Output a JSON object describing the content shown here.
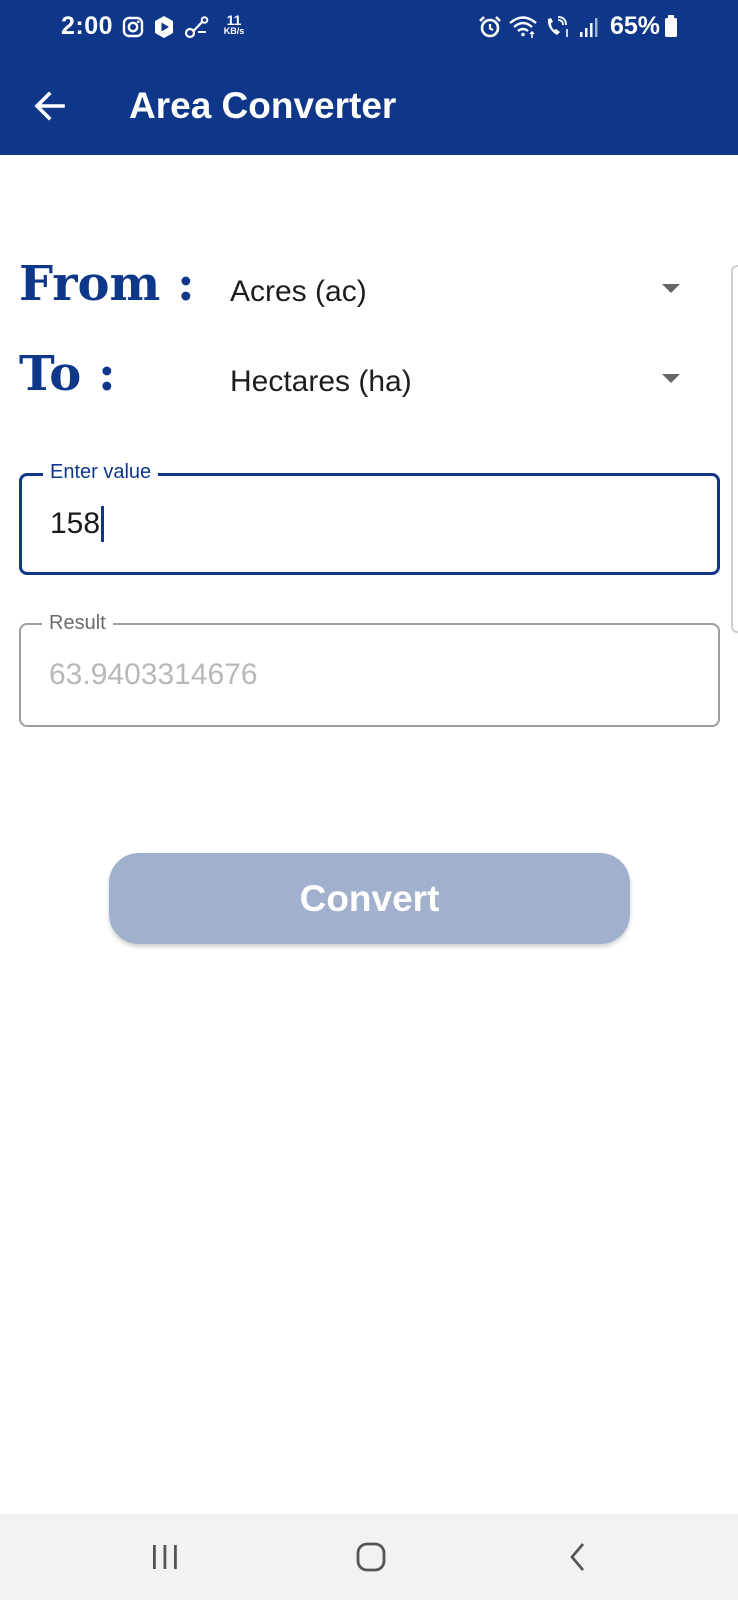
{
  "status_bar": {
    "time": "2:00",
    "net_speed_value": "11",
    "net_speed_unit": "KB/s",
    "battery": "65%",
    "left_icons": [
      "instagram-icon",
      "media-play-icon",
      "link-icon"
    ],
    "right_icons": [
      "alarm-icon",
      "wifi-icon",
      "volte-call-icon",
      "signal-icon",
      "battery-icon"
    ]
  },
  "app_bar": {
    "title": "Area Converter",
    "back_icon": "arrow-back-icon",
    "background_color": "#0e378a"
  },
  "form": {
    "from_label": "From :",
    "from_selected": "Acres (ac)",
    "to_label": "To :",
    "to_selected": "Hectares (ha)",
    "input_label": "Enter value",
    "input_value": "158",
    "result_label": "Result",
    "result_value": "63.9403314676"
  },
  "convert_button": {
    "label": "Convert",
    "color": "#a1b0cc"
  },
  "nav_bar": {
    "icons": [
      "recents-icon",
      "home-icon",
      "back-icon"
    ]
  }
}
